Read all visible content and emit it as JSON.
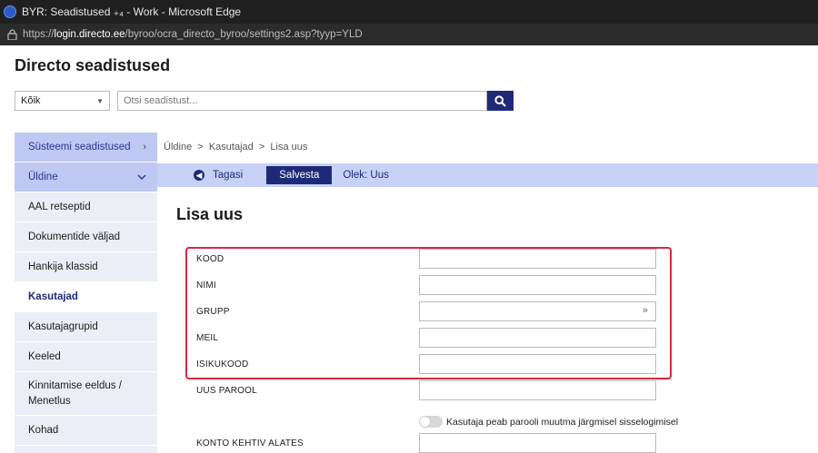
{
  "window": {
    "title": "BYR: Seadistused ₊₄ - Work - Microsoft Edge",
    "url_prefix": "https://",
    "url_host": "login.directo.ee",
    "url_path": "/byroo/ocra_directo_byroo/settings2.asp?tyyp=YLD"
  },
  "app": {
    "title": "Directo seadistused"
  },
  "search": {
    "scope_value": "Kõik",
    "placeholder": "Otsi seadistust..."
  },
  "sidebar": {
    "system_settings": "Süsteemi seadistused",
    "general": "Üldine",
    "items": [
      "AAL retseptid",
      "Dokumentide väljad",
      "Hankija klassid",
      "Kasutajad",
      "Kasutajagrupid",
      "Keeled",
      "Kinnitamise eeldus / Menetlus",
      "Kohad"
    ],
    "active_item": "Kasutajad"
  },
  "breadcrumb": "Üldine  >  Kasutajad  >  Lisa uus",
  "toolbar": {
    "back_label": "Tagasi",
    "save_label": "Salvesta",
    "status_label": "Olek: Uus"
  },
  "form": {
    "heading": "Lisa uus",
    "fields": [
      {
        "label": "KOOD",
        "value": ""
      },
      {
        "label": "NIMI",
        "value": ""
      },
      {
        "label": "GRUPP",
        "value": ""
      },
      {
        "label": "MEIL",
        "value": ""
      },
      {
        "label": "ISIKUKOOD",
        "value": ""
      },
      {
        "label": "UUS PAROOL",
        "value": ""
      },
      {
        "label": "KONTO KEHTIV ALATES",
        "value": ""
      }
    ],
    "toggle_label": "Kasutaja peab parooli muutma järgmisel sisselogimisel",
    "toggle_on": false
  },
  "colors": {
    "accent": "#1e2a78",
    "toolbar_bg": "#c7d1f6",
    "highlight": "#d6293e"
  }
}
